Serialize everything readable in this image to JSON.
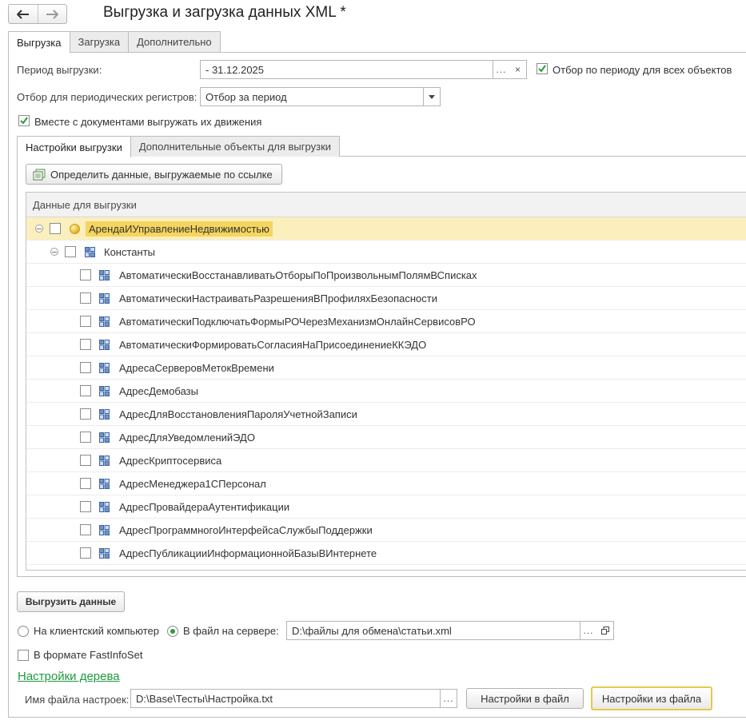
{
  "window": {
    "title": "Выгрузка и загрузка данных XML *"
  },
  "nav": {
    "back_icon": "arrow-left-icon",
    "forward_icon": "arrow-right-icon"
  },
  "main_tabs": [
    {
      "label": "Выгрузка",
      "active": true
    },
    {
      "label": "Загрузка",
      "active": false
    },
    {
      "label": "Дополнительно",
      "active": false
    }
  ],
  "period": {
    "label": "Период выгрузки:",
    "value": "- 31.12.2025",
    "select_button": "...",
    "clear_button": "×",
    "filter_all_label": "Отбор по периоду для всех объектов",
    "filter_all_checked": true
  },
  "periodic_registers": {
    "label": "Отбор для периодических регистров:",
    "value": "Отбор за период"
  },
  "with_movements": {
    "label": "Вместе с документами выгружать их движения",
    "checked": true
  },
  "inner_tabs": [
    {
      "label": "Настройки выгрузки",
      "active": true
    },
    {
      "label": "Дополнительные объекты для выгрузки",
      "active": false
    }
  ],
  "define_button": {
    "label": "Определить данные, выгружаемые по ссылке"
  },
  "tree": {
    "header": "Данные для выгрузки",
    "root": "АрендаИУправлениеНедвижимостью",
    "group": "Константы",
    "items": [
      "АвтоматическиВосстанавливатьОтборыПоПроизвольнымПолямВСписках",
      "АвтоматическиНастраиватьРазрешенияВПрофиляхБезопасности",
      "АвтоматическиПодключатьФормыРОЧерезМеханизмОнлайнСервисовРО",
      "АвтоматическиФормироватьСогласияНаПрисоединениеККЭДО",
      "АдресаСерверовМетокВремени",
      "АдресДемобазы",
      "АдресДляВосстановленияПароляУчетнойЗаписи",
      "АдресДляУведомленийЭДО",
      "АдресКриптосервиса",
      "АдресМенеджера1СПерсонал",
      "АдресПровайдераАутентификации",
      "АдресПрограммногоИнтерфейсаСлужбыПоддержки",
      "АдресПубликацииИнформационнойБазыВИнтернете"
    ]
  },
  "export": {
    "button": "Выгрузить данные",
    "client_option": "На клиентский компьютер",
    "server_option": "В файл на сервере:",
    "server_selected": true,
    "file_path": "D:\\файлы для обмена\\статьи.xml",
    "fastinfoset_label": "В формате FastInfoSet",
    "fastinfoset_checked": false
  },
  "tree_settings": {
    "link": "Настройки дерева",
    "file_label": "Имя файла настроек:",
    "file_value": "D:\\Base\\Тесты\\Настройка.txt",
    "to_file_button": "Настройки в файл",
    "from_file_button": "Настройки из файла"
  },
  "colors": {
    "accent_green": "#1d9b3f",
    "selected_row": "#fbefbd",
    "highlight": "#f5d55f",
    "focus_border": "#e6c94a"
  }
}
